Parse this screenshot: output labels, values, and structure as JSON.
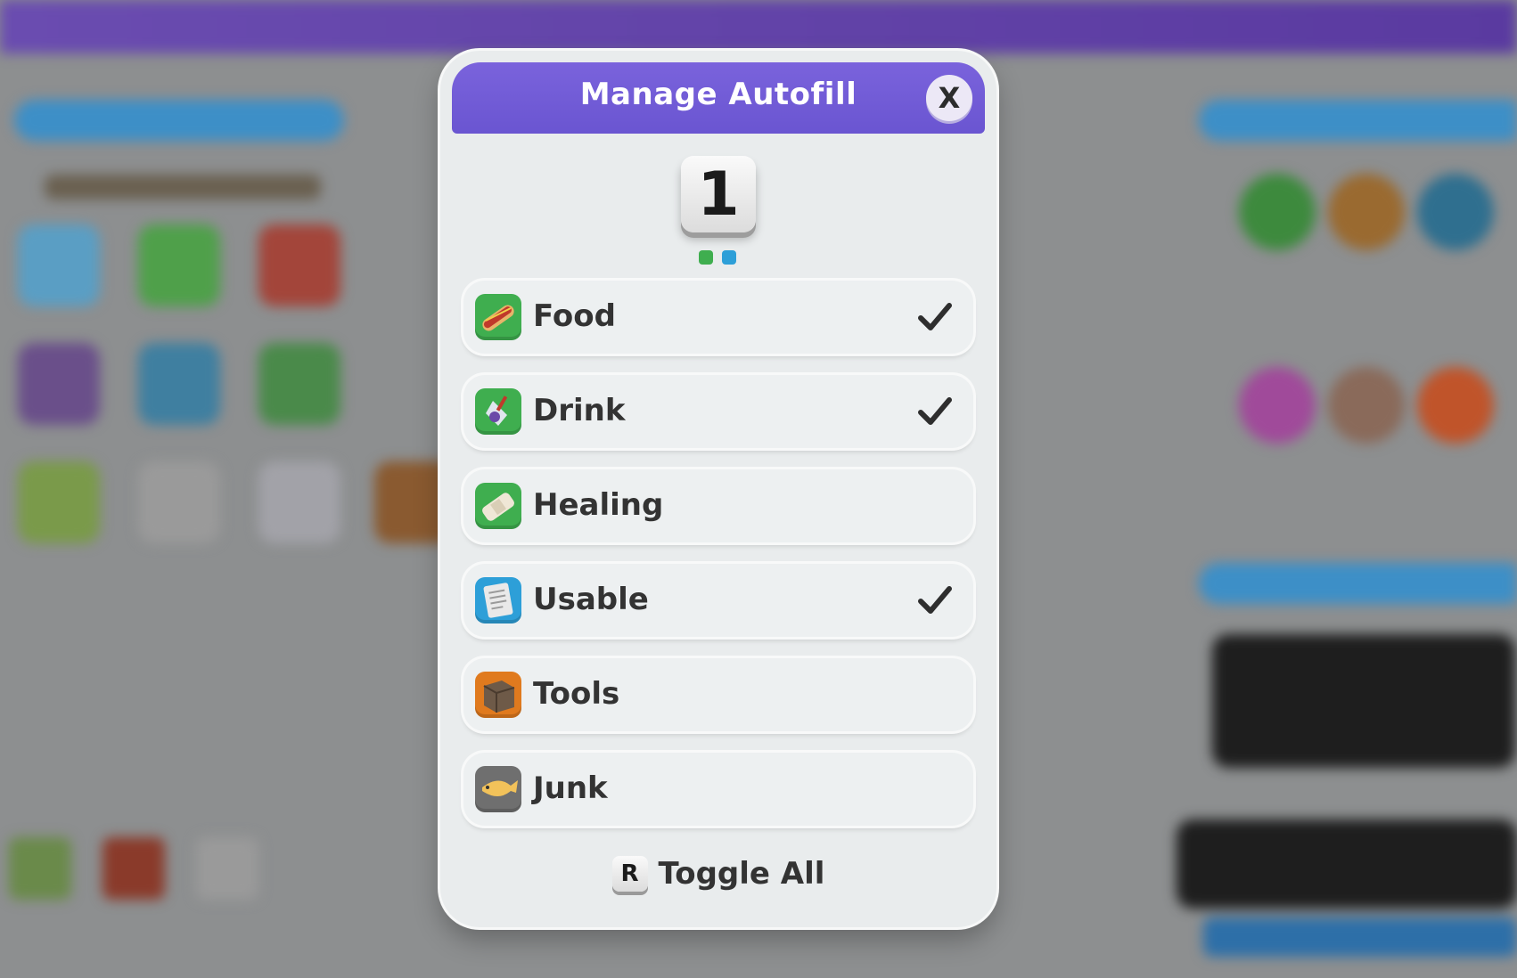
{
  "modal": {
    "title": "Manage Autofill",
    "close_label": "X",
    "page_number": "1",
    "page_dots": [
      "#3fae4f",
      "#2d9fd8"
    ],
    "accent_color": "#7560d8"
  },
  "categories": [
    {
      "label": "Food",
      "checked": true,
      "icon": "hotdog-icon",
      "icon_color": "#3fae4f"
    },
    {
      "label": "Drink",
      "checked": true,
      "icon": "drink-icon",
      "icon_color": "#3fae4f"
    },
    {
      "label": "Healing",
      "checked": false,
      "icon": "bandage-icon",
      "icon_color": "#3fae4f"
    },
    {
      "label": "Usable",
      "checked": true,
      "icon": "paper-icon",
      "icon_color": "#2d9fd8"
    },
    {
      "label": "Tools",
      "checked": false,
      "icon": "crate-icon",
      "icon_color": "#e07a1e"
    },
    {
      "label": "Junk",
      "checked": false,
      "icon": "fish-bone-icon",
      "icon_color": "#6f6f6f"
    }
  ],
  "footer": {
    "key": "R",
    "label": "Toggle All"
  }
}
